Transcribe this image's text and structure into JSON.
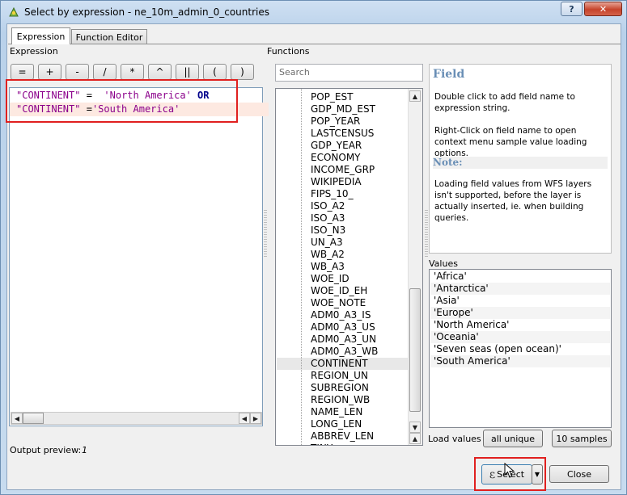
{
  "window": {
    "title": "Select by expression - ne_10m_admin_0_countries",
    "help_label": "?",
    "close_label": "✕"
  },
  "tabs": [
    {
      "label": "Expression",
      "active": true
    },
    {
      "label": "Function Editor",
      "active": false
    }
  ],
  "expression": {
    "section_label": "Expression",
    "operators": [
      "=",
      "+",
      "-",
      "/",
      "*",
      "^",
      "||",
      "(",
      ")"
    ],
    "line1": {
      "field": "\"CONTINENT\"",
      "op": " = ",
      "value": "'North America'",
      "bool": "OR"
    },
    "line2": {
      "field": "\"CONTINENT\"",
      "op": " =",
      "value": "'South America'"
    }
  },
  "functions": {
    "section_label": "Functions",
    "search_placeholder": "Search",
    "items": [
      "POP_EST",
      "GDP_MD_EST",
      "POP_YEAR",
      "LASTCENSUS",
      "GDP_YEAR",
      "ECONOMY",
      "INCOME_GRP",
      "WIKIPEDIA",
      "FIPS_10_",
      "ISO_A2",
      "ISO_A3",
      "ISO_N3",
      "UN_A3",
      "WB_A2",
      "WB_A3",
      "WOE_ID",
      "WOE_ID_EH",
      "WOE_NOTE",
      "ADM0_A3_IS",
      "ADM0_A3_US",
      "ADM0_A3_UN",
      "ADM0_A3_WB",
      "CONTINENT",
      "REGION_UN",
      "SUBREGION",
      "REGION_WB",
      "NAME_LEN",
      "LONG_LEN",
      "ABBREV_LEN",
      "TINY"
    ],
    "highlighted": "CONTINENT"
  },
  "help": {
    "title": "Field",
    "text1": "Double click to add field name to expression string.",
    "text2": "Right-Click on field name to open context menu sample value loading options.",
    "note_title": "Note:",
    "note_text": "Loading field values from WFS layers isn't supported, before the layer is actually inserted, ie. when building queries."
  },
  "values": {
    "label": "Values",
    "items": [
      "'Africa'",
      "'Antarctica'",
      "'Asia'",
      "'Europe'",
      "'North America'",
      "'Oceania'",
      "'Seven seas (open ocean)'",
      "'South America'"
    ],
    "load_label": "Load values",
    "all_unique_label": "all unique",
    "samples_label": "10 samples"
  },
  "output_preview": {
    "label": "Output preview:",
    "value": "1"
  },
  "actions": {
    "select_label": "Select",
    "close_label": "Close"
  },
  "colors": {
    "highlight_box": "#e0201f",
    "field_color": "#8b008b",
    "help_heading": "#6a8fb6"
  }
}
